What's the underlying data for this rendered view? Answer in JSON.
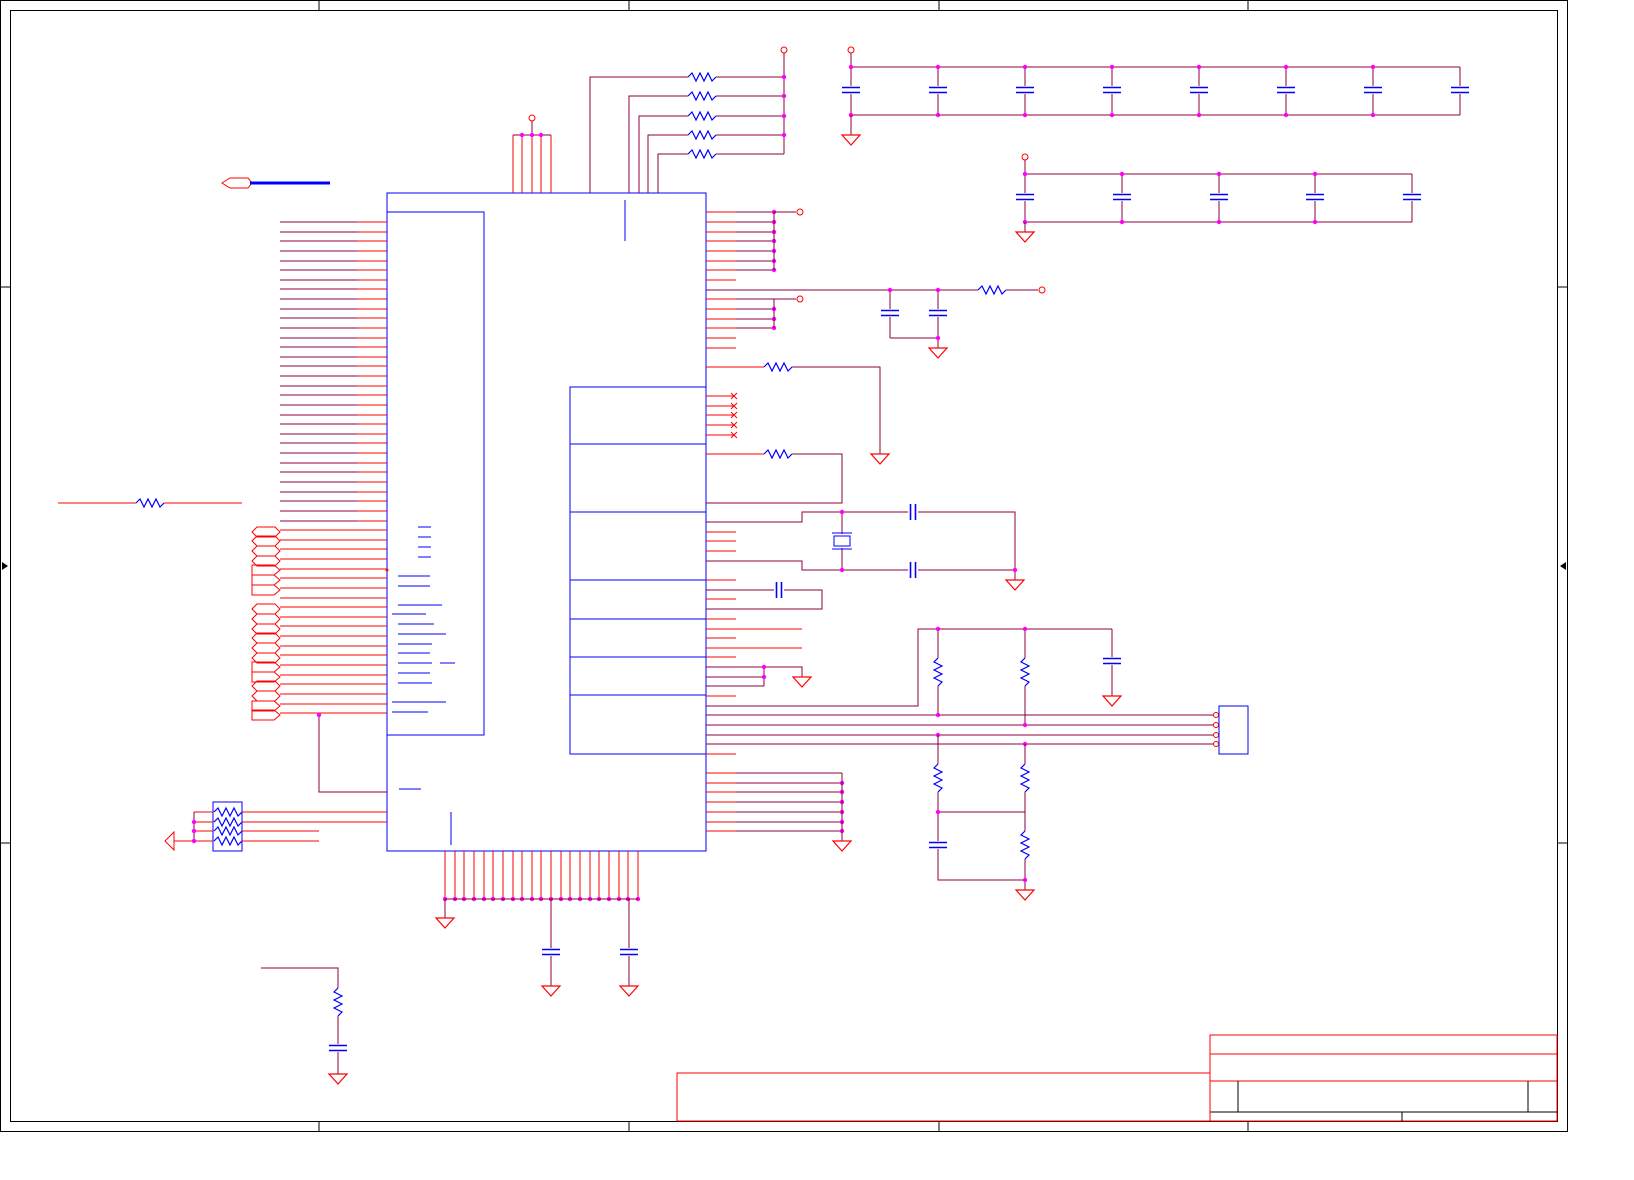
{
  "sheet": {
    "view": "schematic-sheet",
    "has_visible_text": false
  },
  "colors": {
    "frame": "#000000",
    "wire": "#8b0040",
    "pin": "#ff0000",
    "component": "#0000ff",
    "junction": "#ff00ff",
    "background": "#ffffff"
  },
  "components": {
    "main_ic": "ic-body",
    "resistors": "resistor-symbol",
    "capacitors": "capacitor-symbol",
    "crystal": "crystal-symbol",
    "grounds": "ground-symbol",
    "power": "power-port-symbol",
    "connector": "connector-symbol",
    "resistor_network": "resistor-network-symbol",
    "title_block": "title-block"
  }
}
